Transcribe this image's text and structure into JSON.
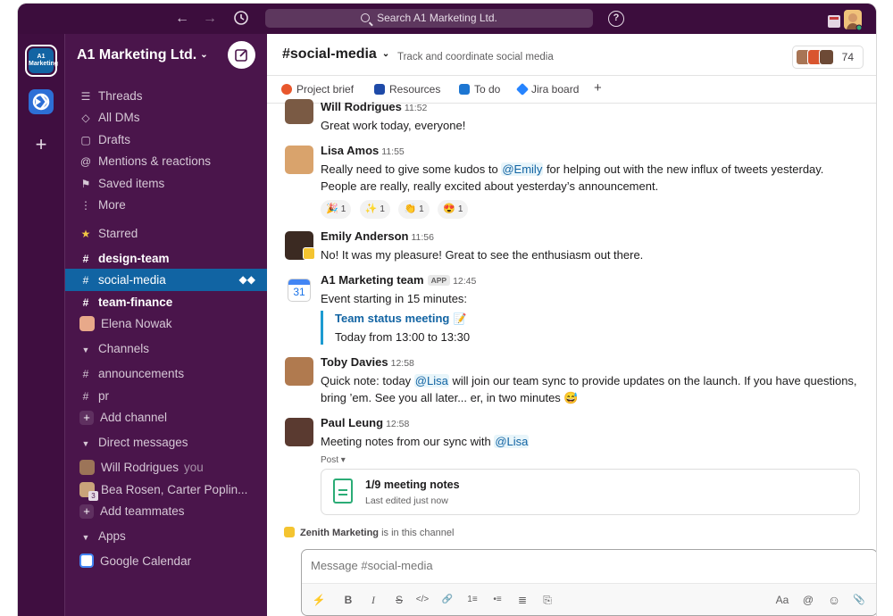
{
  "search": {
    "placeholder": "Search A1 Marketing Ltd."
  },
  "rail": {
    "workspace_badge": "A1 Marketing",
    "add_label": "+"
  },
  "workspace": {
    "name": "A1 Marketing Ltd."
  },
  "sidebar": {
    "nav": [
      {
        "label": "Threads",
        "icon": "threads-icon",
        "glyph": "☰"
      },
      {
        "label": "All DMs",
        "icon": "dms-icon",
        "glyph": "◇"
      },
      {
        "label": "Drafts",
        "icon": "drafts-icon",
        "glyph": "▢"
      },
      {
        "label": "Mentions & reactions",
        "icon": "at-icon",
        "glyph": "@"
      },
      {
        "label": "Saved items",
        "icon": "bookmark-icon",
        "glyph": "⚑"
      },
      {
        "label": "More",
        "icon": "more-icon",
        "glyph": "⋮"
      }
    ],
    "starred_label": "Starred",
    "starred": [
      {
        "label": "design-team"
      },
      {
        "label": "social-media"
      },
      {
        "label": "team-finance"
      },
      {
        "label": "Elena Nowak"
      }
    ],
    "channels_label": "Channels",
    "channels": [
      {
        "label": "announcements"
      },
      {
        "label": "pr"
      }
    ],
    "add_channel": "Add channel",
    "dms_label": "Direct messages",
    "dms": [
      {
        "label": "Will Rodrigues",
        "suffix": "you"
      },
      {
        "label": "Bea Rosen, Carter Poplin...",
        "badge": "3"
      }
    ],
    "add_teammates": "Add teammates",
    "apps_label": "Apps",
    "apps": [
      {
        "label": "Google Calendar"
      }
    ]
  },
  "channel": {
    "name": "#social-media",
    "topic": "Track and coordinate social media",
    "member_count": "74"
  },
  "bookmarks": [
    {
      "label": "Project brief",
      "icon": "canvas-icon",
      "color": "#e8572c"
    },
    {
      "label": "Resources",
      "icon": "folder-icon",
      "color": "#1e4aa8"
    },
    {
      "label": "To do",
      "icon": "trello-icon",
      "color": "#1d76d2"
    },
    {
      "label": "Jira board",
      "icon": "jira-icon",
      "color": "#2684ff"
    }
  ],
  "messages": [
    {
      "author": "Will Rodrigues",
      "time": "11:52",
      "text": "Great work today, everyone!"
    },
    {
      "author": "Lisa Amos",
      "time": "11:55",
      "text_pre": "Really need to give some kudos to ",
      "mention": "@Emily",
      "text_post": " for helping out with the new influx of tweets yesterday.",
      "line2": "People are really, really excited about yesterday’s announcement.",
      "reactions": [
        {
          "emoji": "🎉",
          "count": "1"
        },
        {
          "emoji": "✨",
          "count": "1"
        },
        {
          "emoji": "👏",
          "count": "1"
        },
        {
          "emoji": "😍",
          "count": "1"
        }
      ]
    },
    {
      "author": "Emily Anderson",
      "time": "11:56",
      "text": "No! It was my pleasure! Great to see the enthusiasm out there."
    },
    {
      "author": "A1 Marketing team",
      "tag": "APP",
      "time": "12:45",
      "text": "Event starting in 15 minutes:",
      "event_title": "Team status meeting",
      "event_emoji": "📝",
      "event_time": "Today from 13:00 to 13:30",
      "calendar_day": "31"
    },
    {
      "author": "Toby Davies",
      "time": "12:58",
      "text_pre": "Quick note: today ",
      "mention": "@Lisa",
      "text_post": " will join our team sync to provide updates on the launch. If you have questions,",
      "line2": "bring ’em. See you all later... er, in two minutes 😅"
    },
    {
      "author": "Paul Leung",
      "time": "12:58",
      "text_pre": "Meeting notes from our sync with ",
      "mention": "@Lisa",
      "post_label": "Post ▾",
      "post_title": "1/9 meeting notes",
      "post_sub": "Last edited just now"
    }
  ],
  "in_channel": {
    "name": "Zenith Marketing",
    "suffix": " is in this channel"
  },
  "composer": {
    "placeholder": "Message #social-media",
    "tools": [
      "⚡",
      "B",
      "I",
      "S",
      "</>",
      "🔗",
      "1≡",
      "•≡",
      "≣",
      "⎘"
    ],
    "right_tools": [
      "Aa",
      "@",
      "☺",
      "📎"
    ]
  },
  "colors": {
    "aubergine": "#4a154b",
    "rail": "#3f0e40",
    "active": "#1164a3",
    "link": "#1264a3"
  }
}
